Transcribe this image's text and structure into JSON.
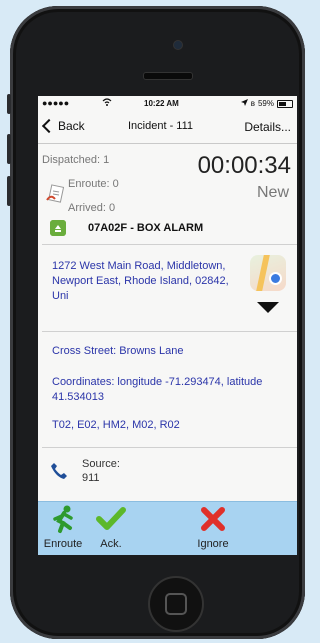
{
  "status_bar": {
    "signal": "●●●●●",
    "time": "10:22 AM",
    "battery_text": "59%",
    "battery_level": 0.59
  },
  "nav": {
    "back_label": "Back",
    "title": "Incident - 111",
    "details_label": "Details..."
  },
  "counts": {
    "dispatched": "Dispatched: 1",
    "enroute": "Enroute: 0",
    "arrived": "Arrived: 0"
  },
  "timer": "00:00:34",
  "incident_state": "New",
  "incident_code": "07A02F - BOX ALARM",
  "address": "1272 West Main Road, Middletown, Newport East, Rhode Island, 02842, Uni",
  "cross_street": "Cross Street: Browns Lane",
  "coordinates": "Coordinates: longitude -71.293474, latitude 41.534013",
  "units": "T02, E02, HM2, M02, R02",
  "source": {
    "label": "Source:",
    "value": "911"
  },
  "actions": {
    "enroute": "Enroute",
    "ack": "Ack.",
    "ignore": "Ignore"
  },
  "colors": {
    "link_blue": "#2b35a9",
    "toolbar_bg": "#a8d3f1",
    "accent_green": "#6aad3c",
    "ignore_red": "#e0302a"
  }
}
